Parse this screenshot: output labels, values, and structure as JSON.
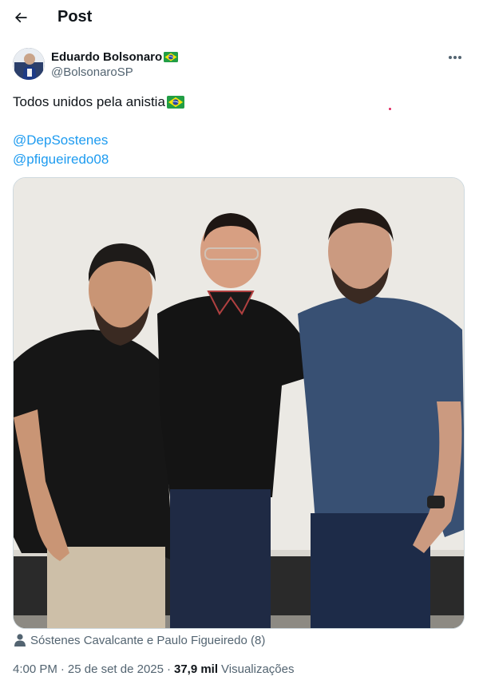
{
  "header": {
    "title": "Post",
    "back_icon": "arrow-left-icon"
  },
  "author": {
    "display_name": "Eduardo Bolsonaro",
    "handle": "@BolsonaroSP",
    "name_emoji": "brazil-flag-icon",
    "more_icon": "more-horizontal-icon"
  },
  "tweet": {
    "text": "Todos unidos pela anistia",
    "text_emoji": "brazil-flag-icon",
    "mentions": [
      "@DepSostenes",
      "@pfigueiredo08"
    ]
  },
  "media": {
    "type": "photo",
    "description_icon": "three-men-posing-photo"
  },
  "tagged": {
    "icon": "person-icon",
    "text": "Sóstenes Cavalcante e Paulo Figueiredo (8)"
  },
  "meta": {
    "time": "4:00 PM",
    "separator": "·",
    "date": "25 de set de 2025",
    "views_count": "37,9 mil",
    "views_label": "Visualizações"
  },
  "colors": {
    "link": "#1d9bf0",
    "secondary_text": "#536471",
    "primary_text": "#0f1419"
  }
}
